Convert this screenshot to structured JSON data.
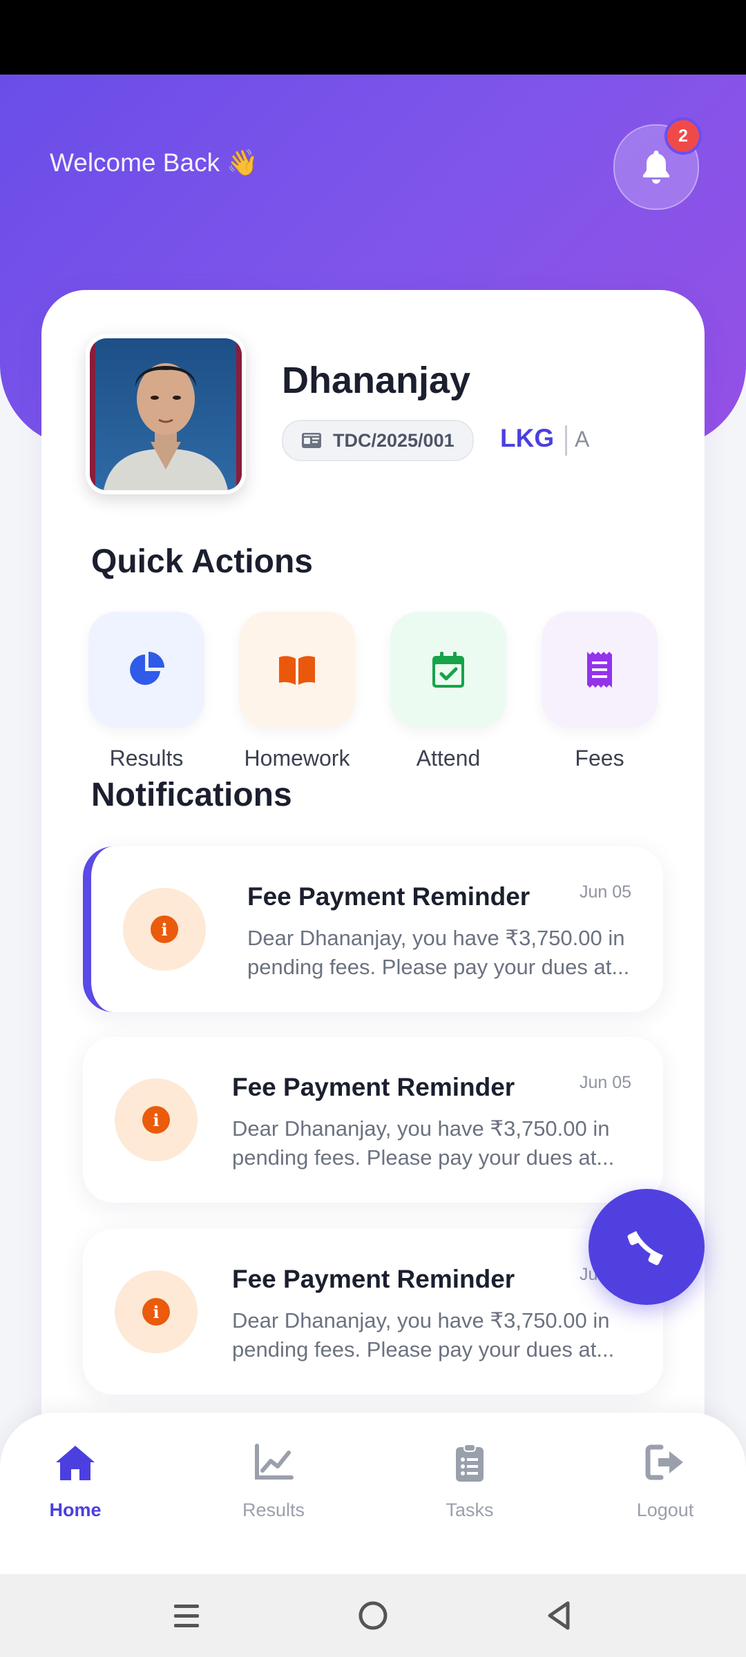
{
  "header": {
    "welcome_text": "Welcome Back 👋",
    "notification_count": "2"
  },
  "student": {
    "name": "Dhananjay",
    "id": "TDC/2025/001",
    "class": "LKG",
    "section": "A"
  },
  "quick_actions": {
    "title": "Quick Actions",
    "items": [
      {
        "label": "Results",
        "icon": "pie-chart-icon",
        "color": "#2f5be8",
        "bg": "#eef3ff"
      },
      {
        "label": "Homework",
        "icon": "book-icon",
        "color": "#ea580c",
        "bg": "#fff4ea"
      },
      {
        "label": "Attend",
        "icon": "calendar-check-icon",
        "color": "#16a34a",
        "bg": "#ecfbf1"
      },
      {
        "label": "Fees",
        "icon": "receipt-icon",
        "color": "#9333ea",
        "bg": "#f7f1fe"
      }
    ]
  },
  "notifications": {
    "title": "Notifications",
    "items": [
      {
        "title": "Fee Payment Reminder",
        "date": "Jun 05",
        "line1": "Dear Dhananjay, you have ₹3,750.00 in",
        "line2": "pending fees. Please pay your dues at..."
      },
      {
        "title": "Fee Payment Reminder",
        "date": "Jun 05",
        "line1": "Dear Dhananjay, you have ₹3,750.00 in",
        "line2": "pending fees. Please pay your dues at..."
      },
      {
        "title": "Fee Payment Reminder",
        "date": "Jun 05",
        "line1": "Dear Dhananjay, you have ₹3,750.00 in",
        "line2": "pending fees. Please pay your dues at..."
      }
    ]
  },
  "bottom_nav": {
    "items": [
      {
        "label": "Home",
        "icon": "home-icon",
        "active": true
      },
      {
        "label": "Results",
        "icon": "chart-line-icon",
        "active": false
      },
      {
        "label": "Tasks",
        "icon": "clipboard-list-icon",
        "active": false
      },
      {
        "label": "Logout",
        "icon": "logout-icon",
        "active": false
      }
    ]
  },
  "colors": {
    "accent": "#4b3fe0",
    "hero_start": "#6a4de8",
    "hero_end": "#9550e6",
    "badge": "#ef4a4a"
  }
}
